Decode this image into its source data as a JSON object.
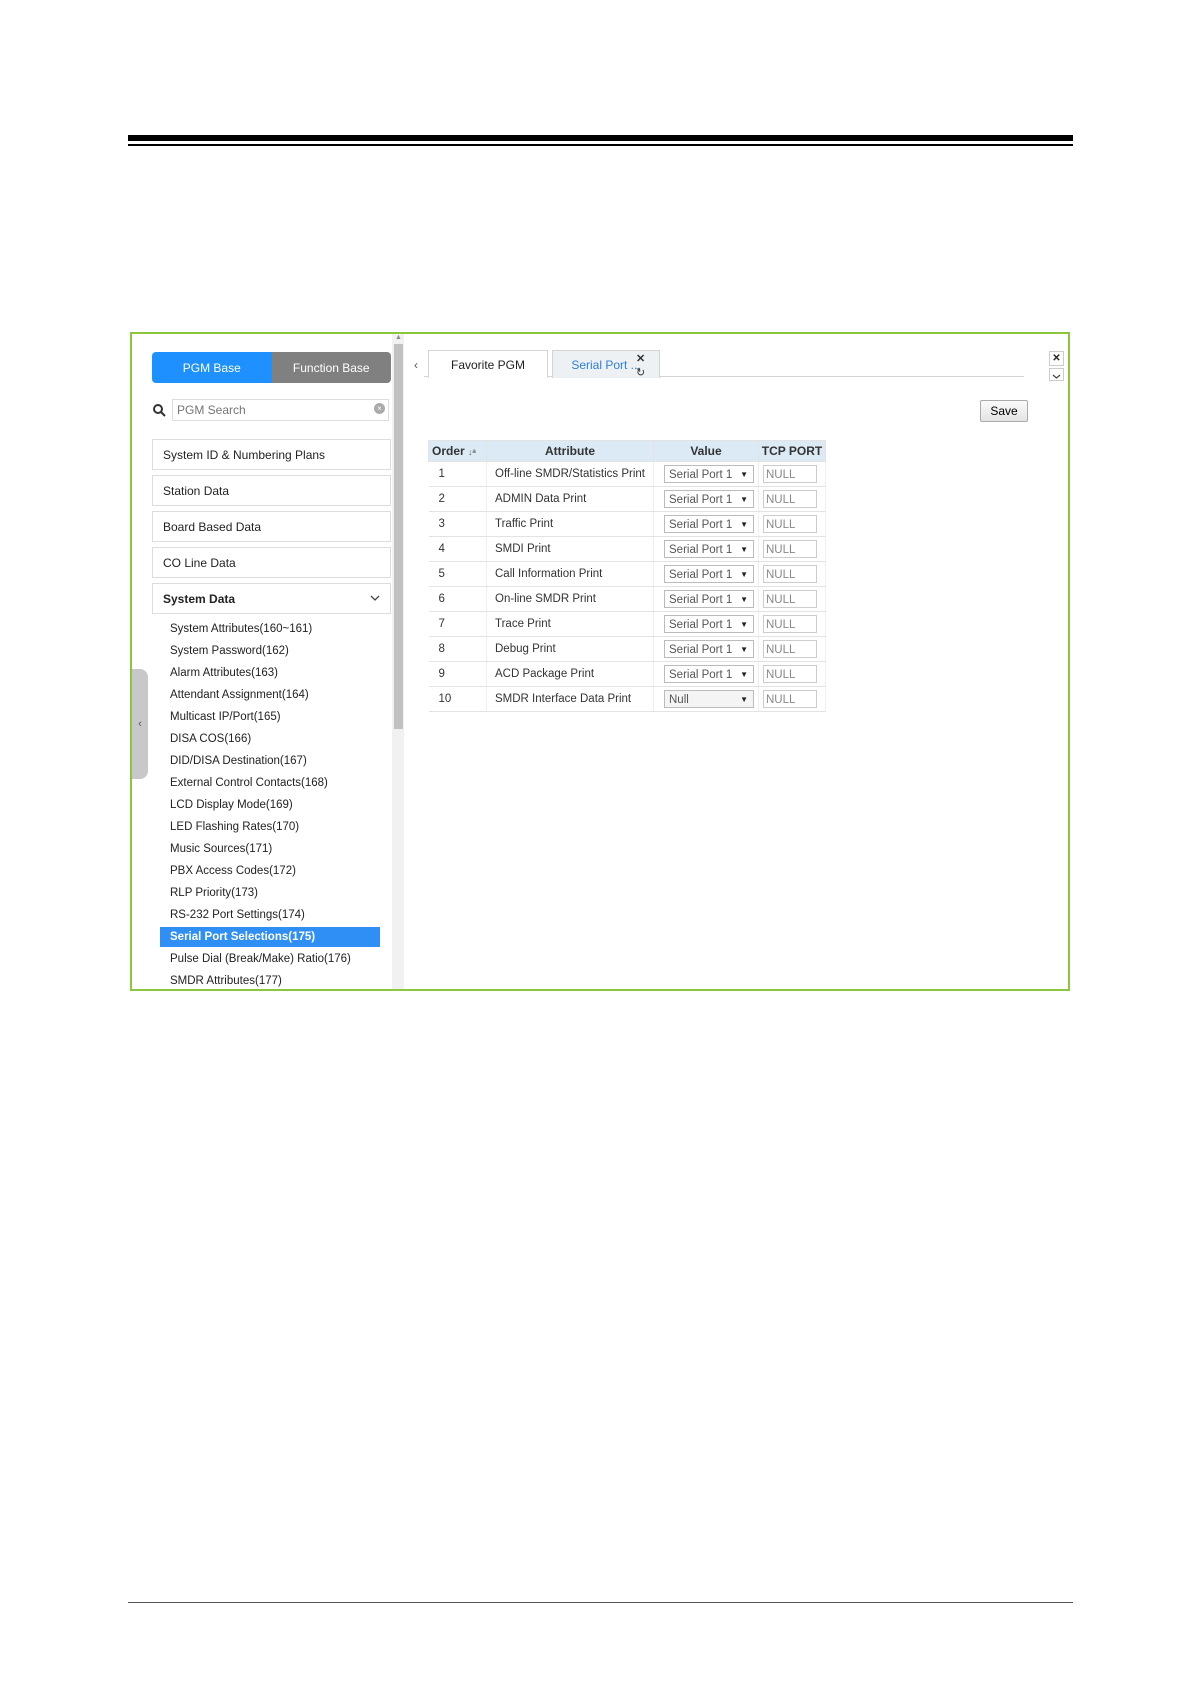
{
  "left_panel": {
    "toggle": {
      "pgm_base": "PGM Base",
      "function_base": "Function Base"
    },
    "search": {
      "placeholder": "PGM Search"
    },
    "menu": [
      {
        "label": "System ID & Numbering Plans"
      },
      {
        "label": "Station Data"
      },
      {
        "label": "Board Based Data"
      },
      {
        "label": "CO Line Data"
      },
      {
        "label": "System Data"
      }
    ],
    "system_data_items": [
      "System Attributes(160~161)",
      "System Password(162)",
      "Alarm Attributes(163)",
      "Attendant Assignment(164)",
      "Multicast IP/Port(165)",
      "DISA COS(166)",
      "DID/DISA Destination(167)",
      "External Control Contacts(168)",
      "LCD Display Mode(169)",
      "LED Flashing Rates(170)",
      "Music Sources(171)",
      "PBX Access Codes(172)",
      "RLP Priority(173)",
      "RS-232 Port Settings(174)",
      "Serial Port Selections(175)",
      "Pulse Dial (Break/Make) Ratio(176)",
      "SMDR Attributes(177)"
    ],
    "active_item": "Serial Port Selections(175)"
  },
  "tabs": {
    "back": "‹",
    "items": [
      "Favorite PGM",
      "Serial Port ..."
    ],
    "active": "Serial Port ..."
  },
  "toolbar": {
    "save_label": "Save"
  },
  "table": {
    "headers": {
      "order": "Order",
      "attribute": "Attribute",
      "value": "Value",
      "tcp_port": "TCP PORT"
    },
    "rows": [
      {
        "order": "1",
        "attribute": "Off-line SMDR/Statistics Print",
        "value": "Serial Port 1",
        "tcp": "NULL"
      },
      {
        "order": "2",
        "attribute": "ADMIN Data Print",
        "value": "Serial Port 1",
        "tcp": "NULL"
      },
      {
        "order": "3",
        "attribute": "Traffic Print",
        "value": "Serial Port 1",
        "tcp": "NULL"
      },
      {
        "order": "4",
        "attribute": "SMDI Print",
        "value": "Serial Port 1",
        "tcp": "NULL"
      },
      {
        "order": "5",
        "attribute": "Call Information Print",
        "value": "Serial Port 1",
        "tcp": "NULL"
      },
      {
        "order": "6",
        "attribute": "On-line SMDR Print",
        "value": "Serial Port 1",
        "tcp": "NULL"
      },
      {
        "order": "7",
        "attribute": "Trace Print",
        "value": "Serial Port 1",
        "tcp": "NULL"
      },
      {
        "order": "8",
        "attribute": "Debug Print",
        "value": "Serial Port 1",
        "tcp": "NULL"
      },
      {
        "order": "9",
        "attribute": "ACD Package Print",
        "value": "Serial Port 1",
        "tcp": "NULL"
      },
      {
        "order": "10",
        "attribute": "SMDR Interface Data Print",
        "value": "Null",
        "tcp": "NULL"
      }
    ]
  },
  "colors": {
    "frame_border": "#8cc63f",
    "accent_blue": "#1e90ff",
    "header_bg": "#dbeaf5"
  }
}
